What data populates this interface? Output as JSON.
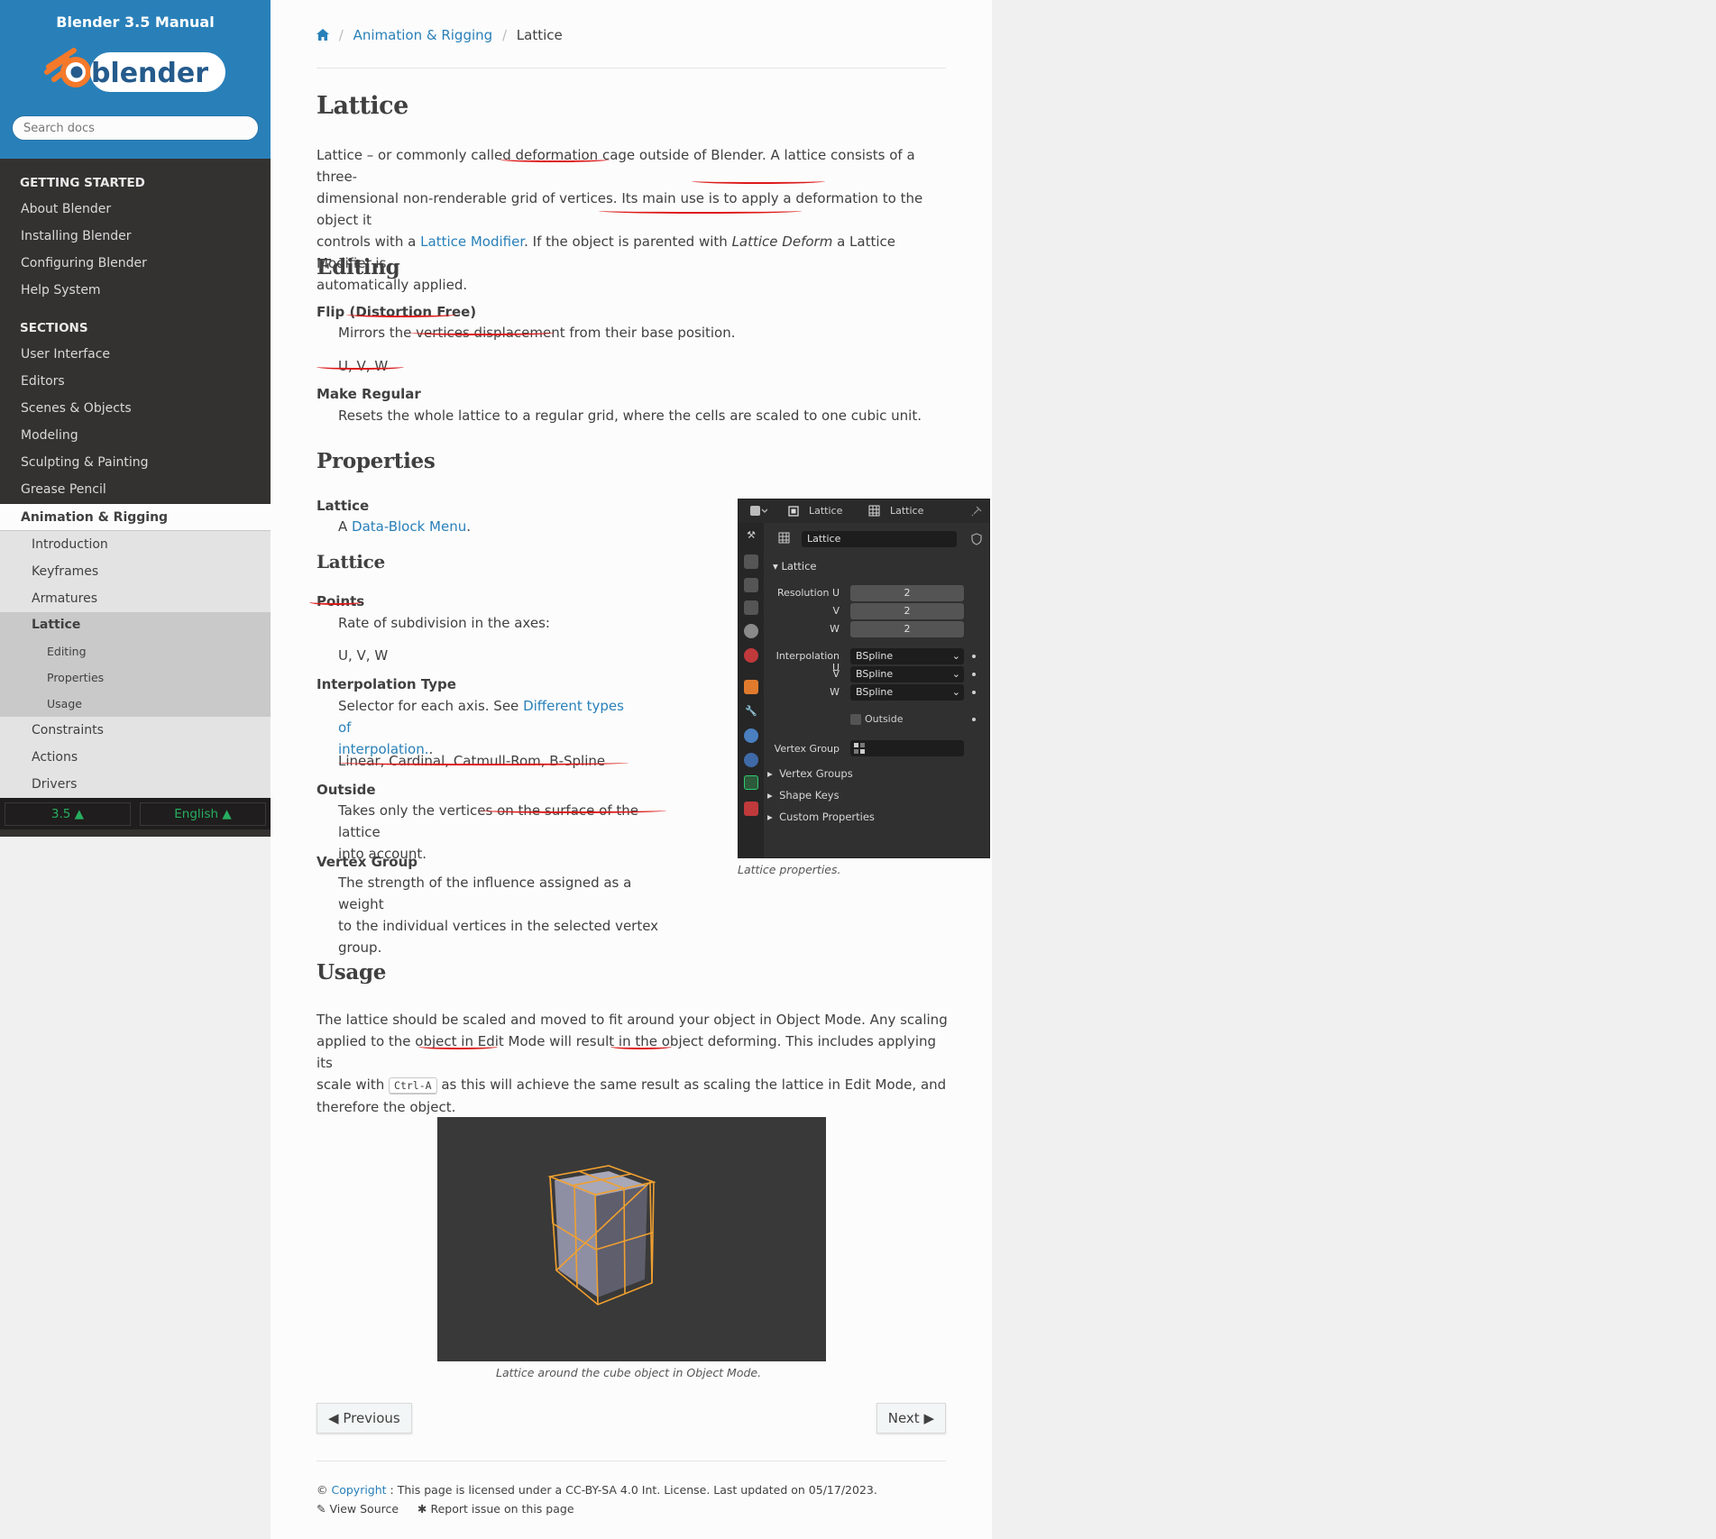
{
  "sidebar": {
    "title": "Blender 3.5 Manual",
    "logo_text": "blender",
    "search_placeholder": "Search docs",
    "caption_getting_started": "GETTING STARTED",
    "getting_started": [
      "About Blender",
      "Installing Blender",
      "Configuring Blender",
      "Help System"
    ],
    "caption_sections": "SECTIONS",
    "sections": [
      "User Interface",
      "Editors",
      "Scenes & Objects",
      "Modeling",
      "Sculpting & Painting",
      "Grease Pencil"
    ],
    "current_section": "Animation & Rigging",
    "anim_items_before": [
      "Introduction",
      "Keyframes",
      "Armatures"
    ],
    "current_page": "Lattice",
    "page_toc": [
      "Editing",
      "Properties",
      "Usage"
    ],
    "anim_items_after": [
      "Constraints",
      "Actions",
      "Drivers"
    ],
    "version": "3.5 ▲",
    "language": "English ▲"
  },
  "breadcrumb": {
    "home_icon": "home-icon",
    "section": "Animation & Rigging",
    "page": "Lattice"
  },
  "page": {
    "title": "Lattice",
    "intro": {
      "t1": "Lattice – or commonly called deformation cage outside of Blender. A lattice consists of a three-",
      "t2": "dimensional non-renderable grid of vertices. Its main use is to apply a deformation to the object it",
      "t3a": "controls with a ",
      "t3link": "Lattice Modifier",
      "t3b": ". If the object is parented with ",
      "t3em": "Lattice Deform",
      "t3c": " a Lattice Modifier is",
      "t4": "automatically applied."
    },
    "editing": {
      "heading": "Editing",
      "flip_term": "Flip (Distortion Free)",
      "flip_desc": "Mirrors the vertices displacement from their base position.",
      "flip_axes": "U, V, W",
      "regular_term": "Make Regular",
      "regular_desc": "Resets the whole lattice to a regular grid, where the cells are scaled to one cubic unit."
    },
    "properties": {
      "heading": "Properties",
      "lattice_term": "Lattice",
      "lattice_desc_a": "A ",
      "lattice_desc_link": "Data-Block Menu",
      "lattice_desc_b": ".",
      "sub_heading": "Lattice",
      "points_term": "Points",
      "points_desc": "Rate of subdivision in the axes:",
      "points_axes": "U, V, W",
      "interp_term": "Interpolation Type",
      "interp_desc_a": "Selector for each axis. See ",
      "interp_link_1": "Different types of",
      "interp_link_2": "interpolation.",
      "interp_desc_b": ".",
      "interp_values": "Linear, Cardinal, Catmull-Rom, B-Spline",
      "outside_term": "Outside",
      "outside_desc_1": "Takes only the vertices on the surface of the lattice",
      "outside_desc_2": "into account.",
      "vgroup_term": "Vertex Group",
      "vgroup_desc_1": "The strength of the influence assigned as a weight",
      "vgroup_desc_2": "to the individual vertices in the selected vertex",
      "vgroup_desc_3": "group.",
      "figure_caption": "Lattice properties."
    },
    "usage": {
      "heading": "Usage",
      "l1": "The lattice should be scaled and moved to fit around your object in Object Mode. Any scaling",
      "l2": "applied to the object in Edit Mode will result in the object deforming. This includes applying its",
      "l3a": "scale with ",
      "kbd": "Ctrl-A",
      "l3b": " as this will achieve the same result as scaling the lattice in Edit Mode, and",
      "l4": "therefore the object.",
      "figure_caption": "Lattice around the cube object in Object Mode."
    },
    "nav": {
      "previous": "Previous",
      "next": "Next"
    },
    "footer": {
      "copyright_sym": "© ",
      "copyright_link": "Copyright",
      "license": " : This page is licensed under a CC-BY-SA 4.0 Int. License. Last updated on 05/17/2023.",
      "view_source": "View Source",
      "report_issue": "Report issue on this page"
    }
  },
  "blender_panel": {
    "header_object": "Lattice",
    "header_data": "Lattice",
    "datablock_name": "Lattice",
    "panel_title": "Lattice",
    "resolution_label": "Resolution U",
    "v_label": "V",
    "w_label": "W",
    "resolution_u": "2",
    "resolution_v": "2",
    "resolution_w": "2",
    "interp_label": "Interpolation U",
    "interp_u": "BSpline",
    "interp_v": "BSpline",
    "interp_w": "BSpline",
    "outside_label": "Outside",
    "vertex_group_label": "Vertex Group",
    "sub_panels": [
      "Vertex Groups",
      "Shape Keys",
      "Custom Properties"
    ]
  },
  "colors": {
    "sidebar_top": "#2980b9",
    "sidebar_bg": "#343131",
    "link": "#2980b9",
    "annotation_red": "#dd1a1a",
    "lattice_orange": "#f0a030"
  }
}
